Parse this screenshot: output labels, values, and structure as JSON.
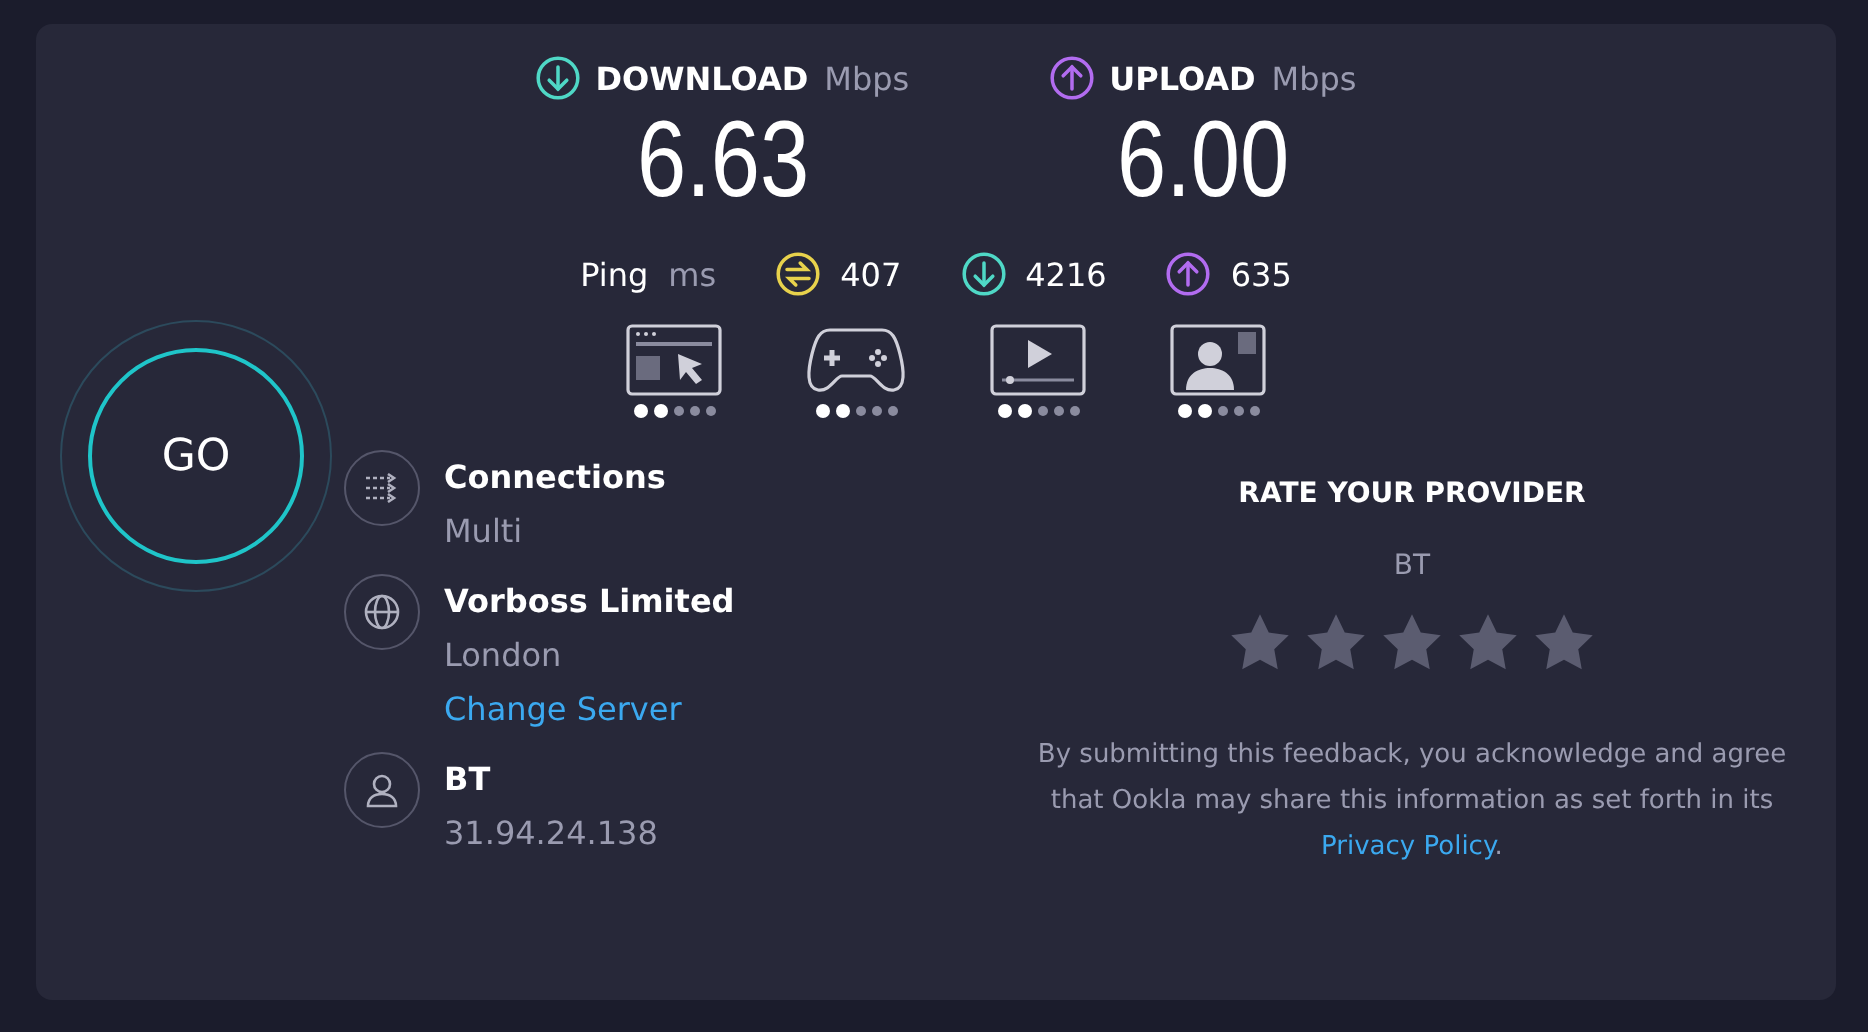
{
  "speeds": [
    {
      "kind": "download",
      "label": "DOWNLOAD",
      "unit": "Mbps",
      "value": "6.63"
    },
    {
      "kind": "upload",
      "label": "UPLOAD",
      "unit": "Mbps",
      "value": "6.00"
    }
  ],
  "ping": {
    "label": "Ping",
    "unit": "ms",
    "readings": [
      {
        "kind": "idle",
        "value": "407"
      },
      {
        "kind": "download",
        "value": "4216"
      },
      {
        "kind": "upload",
        "value": "635"
      }
    ]
  },
  "activities": [
    {
      "kind": "browsing",
      "level": 0.4
    },
    {
      "kind": "gaming",
      "level": 0.4
    },
    {
      "kind": "streaming",
      "level": 0.4
    },
    {
      "kind": "video-call",
      "level": 0.4
    }
  ],
  "go_button": "GO",
  "details": [
    {
      "kind": "connections",
      "title": "Connections",
      "lines": [
        "Multi"
      ]
    },
    {
      "kind": "server",
      "title": "Vorboss Limited",
      "lines": [
        "London"
      ],
      "link": "Change Server"
    },
    {
      "kind": "provider",
      "title": "BT",
      "lines": [
        "31.94.24.138"
      ]
    }
  ],
  "rating": {
    "title": "RATE YOUR PROVIDER",
    "provider": "BT",
    "stars": 0,
    "disclaimer": "By submitting this feedback, you acknowledge and agree that Ookla may share this information as set forth in its ",
    "link": "Privacy Policy",
    "after": "."
  }
}
